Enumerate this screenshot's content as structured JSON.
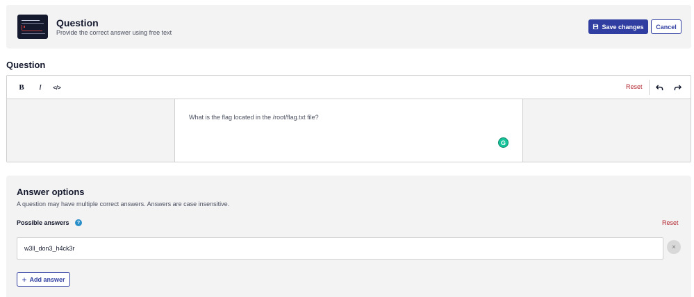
{
  "header": {
    "title": "Question",
    "subtitle": "Provide the correct answer using free text",
    "save_label": "Save changes",
    "cancel_label": "Cancel"
  },
  "question": {
    "section_title": "Question",
    "toolbar": {
      "bold_label": "B",
      "italic_label": "I",
      "code_label": "</>",
      "reset_label": "Reset"
    },
    "text": "What is the flag located in the /root/flag.txt file?",
    "grammarly_label": "G"
  },
  "answers": {
    "title": "Answer options",
    "subtitle": "A question may have multiple correct answers. Answers are case insensitive.",
    "possible_label": "Possible answers",
    "help_label": "?",
    "reset_label": "Reset",
    "items": [
      {
        "value": "w3ll_don3_h4ck3r"
      }
    ],
    "remove_label": "×",
    "add_plus": "+",
    "add_label": "Add answer"
  },
  "colors": {
    "primary": "#2f3ea0",
    "danger": "#b3262f",
    "panel_bg": "#f3f3f3"
  },
  "icons": [
    "save-icon",
    "bold-icon",
    "italic-icon",
    "code-icon",
    "undo-icon",
    "redo-icon",
    "grammarly-icon",
    "help-icon",
    "remove-icon",
    "plus-icon"
  ]
}
